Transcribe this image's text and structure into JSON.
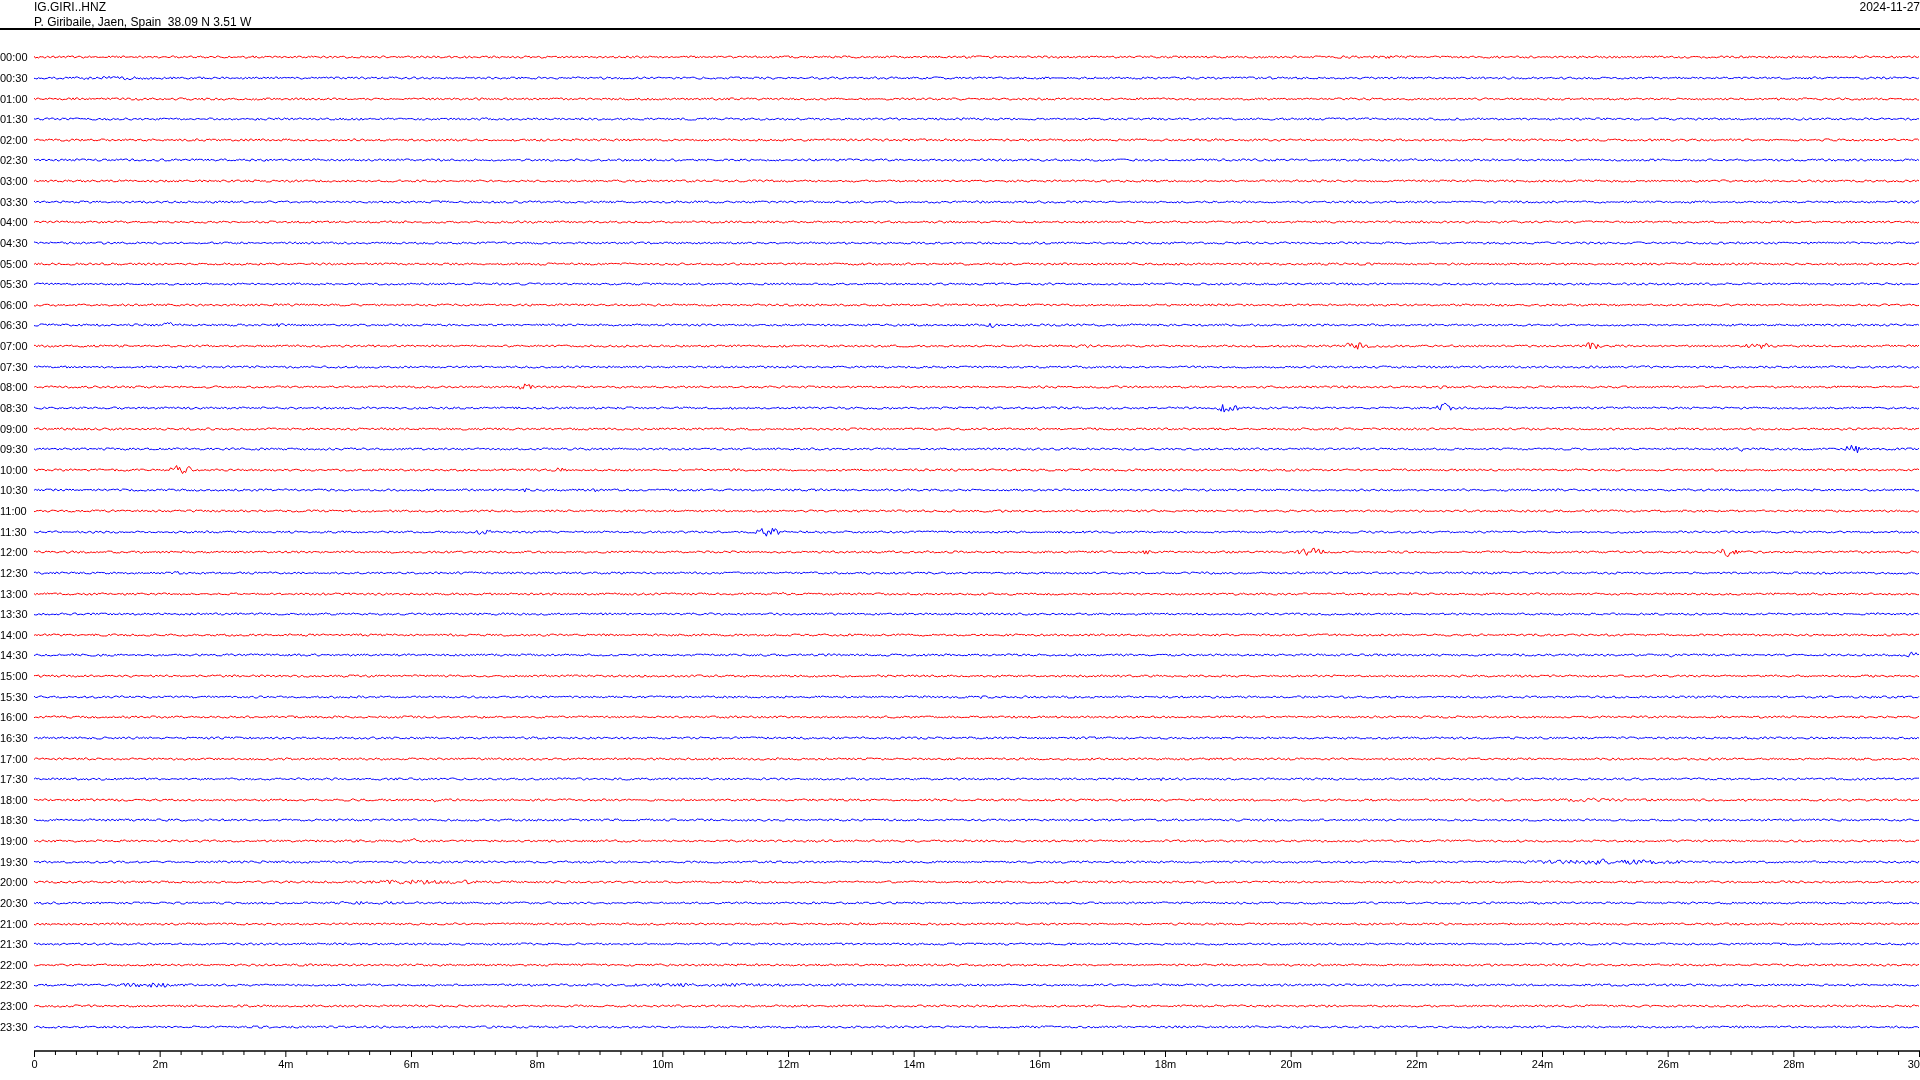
{
  "header": {
    "station": "IG.GIRI..HNZ",
    "location": "P. Giribaile, Jaen, Spain  38.09 N 3.51 W",
    "date": "2024-11-27"
  },
  "rows": [
    {
      "time": "00:00",
      "color": "#ff0000"
    },
    {
      "time": "00:30",
      "color": "#0000ff"
    },
    {
      "time": "01:00",
      "color": "#ff0000"
    },
    {
      "time": "01:30",
      "color": "#0000ff"
    },
    {
      "time": "02:00",
      "color": "#ff0000"
    },
    {
      "time": "02:30",
      "color": "#0000ff"
    },
    {
      "time": "03:00",
      "color": "#ff0000"
    },
    {
      "time": "03:30",
      "color": "#0000ff"
    },
    {
      "time": "04:00",
      "color": "#ff0000"
    },
    {
      "time": "04:30",
      "color": "#0000ff"
    },
    {
      "time": "05:00",
      "color": "#ff0000"
    },
    {
      "time": "05:30",
      "color": "#0000ff"
    },
    {
      "time": "06:00",
      "color": "#ff0000"
    },
    {
      "time": "06:30",
      "color": "#0000ff"
    },
    {
      "time": "07:00",
      "color": "#ff0000"
    },
    {
      "time": "07:30",
      "color": "#0000ff"
    },
    {
      "time": "08:00",
      "color": "#ff0000"
    },
    {
      "time": "08:30",
      "color": "#0000ff"
    },
    {
      "time": "09:00",
      "color": "#ff0000"
    },
    {
      "time": "09:30",
      "color": "#0000ff"
    },
    {
      "time": "10:00",
      "color": "#ff0000"
    },
    {
      "time": "10:30",
      "color": "#0000ff"
    },
    {
      "time": "11:00",
      "color": "#ff0000"
    },
    {
      "time": "11:30",
      "color": "#0000ff"
    },
    {
      "time": "12:00",
      "color": "#ff0000"
    },
    {
      "time": "12:30",
      "color": "#0000ff"
    },
    {
      "time": "13:00",
      "color": "#ff0000"
    },
    {
      "time": "13:30",
      "color": "#0000ff"
    },
    {
      "time": "14:00",
      "color": "#ff0000"
    },
    {
      "time": "14:30",
      "color": "#0000ff"
    },
    {
      "time": "15:00",
      "color": "#ff0000"
    },
    {
      "time": "15:30",
      "color": "#0000ff"
    },
    {
      "time": "16:00",
      "color": "#ff0000"
    },
    {
      "time": "16:30",
      "color": "#0000ff"
    },
    {
      "time": "17:00",
      "color": "#ff0000"
    },
    {
      "time": "17:30",
      "color": "#0000ff"
    },
    {
      "time": "18:00",
      "color": "#ff0000"
    },
    {
      "time": "18:30",
      "color": "#0000ff"
    },
    {
      "time": "19:00",
      "color": "#ff0000"
    },
    {
      "time": "19:30",
      "color": "#0000ff"
    },
    {
      "time": "20:00",
      "color": "#ff0000"
    },
    {
      "time": "20:30",
      "color": "#0000ff"
    },
    {
      "time": "21:00",
      "color": "#ff0000"
    },
    {
      "time": "21:30",
      "color": "#0000ff"
    },
    {
      "time": "22:00",
      "color": "#ff0000"
    },
    {
      "time": "22:30",
      "color": "#0000ff"
    },
    {
      "time": "23:00",
      "color": "#ff0000"
    },
    {
      "time": "23:30",
      "color": "#0000ff"
    }
  ],
  "x_axis": {
    "labels": [
      "0",
      "2m",
      "4m",
      "6m",
      "8m",
      "10m",
      "12m",
      "14m",
      "16m",
      "18m",
      "20m",
      "22m",
      "24m",
      "26m",
      "28m",
      "30"
    ]
  }
}
